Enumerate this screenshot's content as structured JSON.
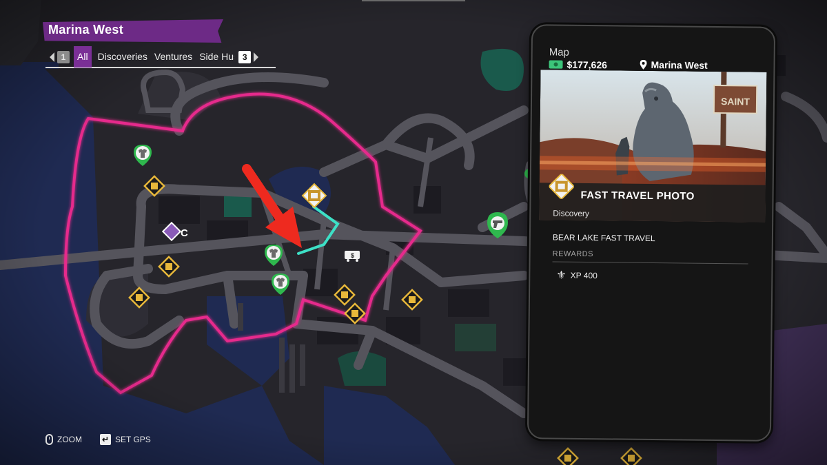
{
  "district": {
    "name": "Marina West"
  },
  "filters": {
    "prev_key": "1",
    "next_key": "3",
    "tabs": [
      "All",
      "Discoveries",
      "Ventures",
      "Side Hus"
    ],
    "active_tab": "All"
  },
  "controls": {
    "zoom_label": "ZOOM",
    "gps_label": "SET GPS"
  },
  "panel": {
    "title": "Map",
    "money": "$177,626",
    "location": "Marina West",
    "card_title": "FAST TRAVEL PHOTO",
    "card_type": "Discovery",
    "detail_name": "BEAR LAKE FAST TRAVEL",
    "rewards_label": "REWARDS",
    "reward": "XP 400",
    "sign_text": "SAINT"
  },
  "colors": {
    "district_border": "#e62a8c",
    "route": "#3de0c6",
    "banner": "#6d2a86",
    "annotation_arrow": "#ee2a1f",
    "marker_gold": "#e8b83a",
    "marker_green": "#2fb84e"
  },
  "icons": [
    "wardrobe-icon",
    "discovery-icon",
    "collectible-c-icon",
    "cash-van-icon",
    "gun-shop-icon",
    "money-icon",
    "pin-icon",
    "fleur-de-lis-icon",
    "mouse-icon",
    "enter-key-icon"
  ]
}
